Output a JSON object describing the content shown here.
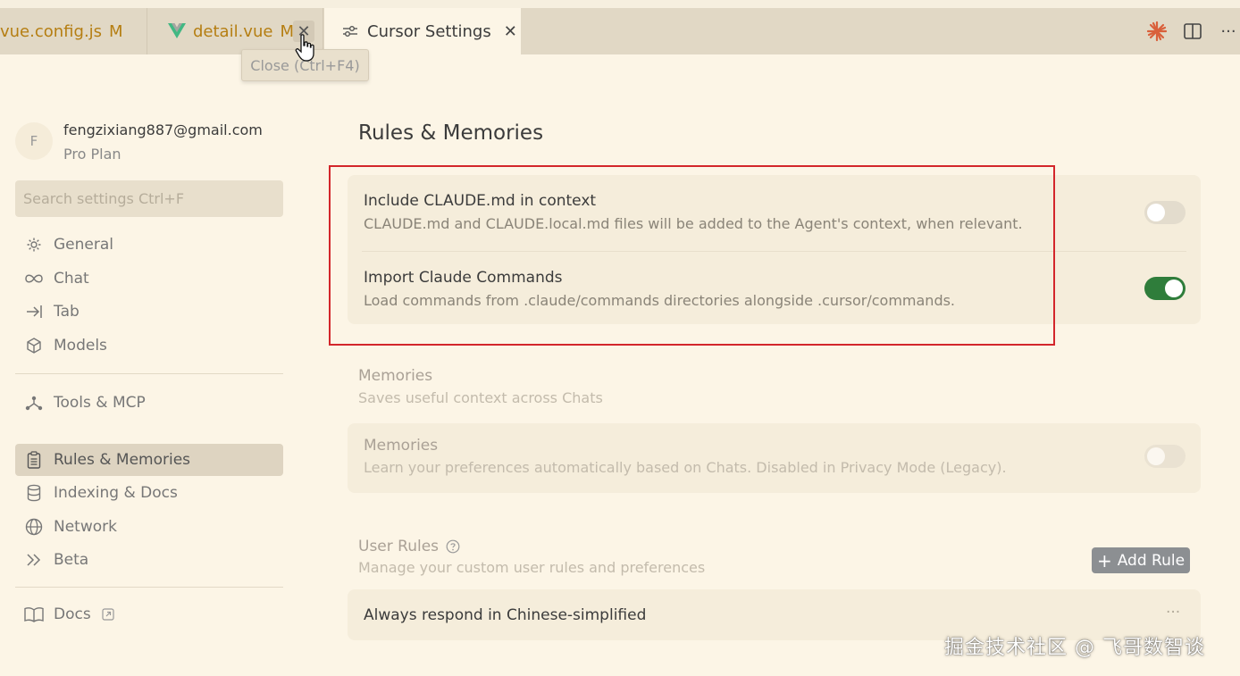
{
  "tabs": [
    {
      "label": "vue.config.js",
      "modified": "M"
    },
    {
      "label": "detail.vue",
      "modified": "M"
    },
    {
      "label": "Cursor Settings"
    }
  ],
  "tooltip": "Close (Ctrl+F4)",
  "account": {
    "avatar_letter": "F",
    "email": "fengzixiang887@gmail.com",
    "plan": "Pro Plan"
  },
  "search": {
    "placeholder": "Search settings Ctrl+F"
  },
  "sidebar": {
    "items": [
      {
        "label": "General",
        "icon": "gear-icon"
      },
      {
        "label": "Chat",
        "icon": "infinity-icon"
      },
      {
        "label": "Tab",
        "icon": "arrow-to-line-icon"
      },
      {
        "label": "Models",
        "icon": "cube-icon"
      },
      {
        "label": "Tools & MCP",
        "icon": "network-nodes-icon"
      },
      {
        "label": "Rules & Memories",
        "icon": "clipboard-icon",
        "active": true
      },
      {
        "label": "Indexing & Docs",
        "icon": "database-icon"
      },
      {
        "label": "Network",
        "icon": "globe-icon"
      },
      {
        "label": "Beta",
        "icon": "double-chevron-icon"
      },
      {
        "label": "Docs",
        "icon": "book-icon"
      }
    ]
  },
  "main": {
    "title": "Rules & Memories",
    "claude": {
      "include_title": "Include CLAUDE.md in context",
      "include_desc": "CLAUDE.md and CLAUDE.local.md files will be added to the Agent's context, when relevant.",
      "include_on": false,
      "import_title": "Import Claude Commands",
      "import_desc": "Load commands from .claude/commands directories alongside .cursor/commands.",
      "import_on": true
    },
    "memories": {
      "section_title": "Memories",
      "section_desc": "Saves useful context across Chats",
      "row_title": "Memories",
      "row_desc": "Learn your preferences automatically based on Chats. Disabled in Privacy Mode (Legacy).",
      "on": false
    },
    "user_rules": {
      "title": "User Rules",
      "desc": "Manage your custom user rules and preferences",
      "add_label": "Add Rule",
      "rules": [
        "Always respond in Chinese-simplified"
      ],
      "more": "···"
    }
  },
  "watermark": "掘金技术社区 @ 飞哥数智谈",
  "colors": {
    "toggle_on": "#2f7d3b",
    "highlight_box": "#d3262b",
    "tab_modified": "#b57e12"
  }
}
